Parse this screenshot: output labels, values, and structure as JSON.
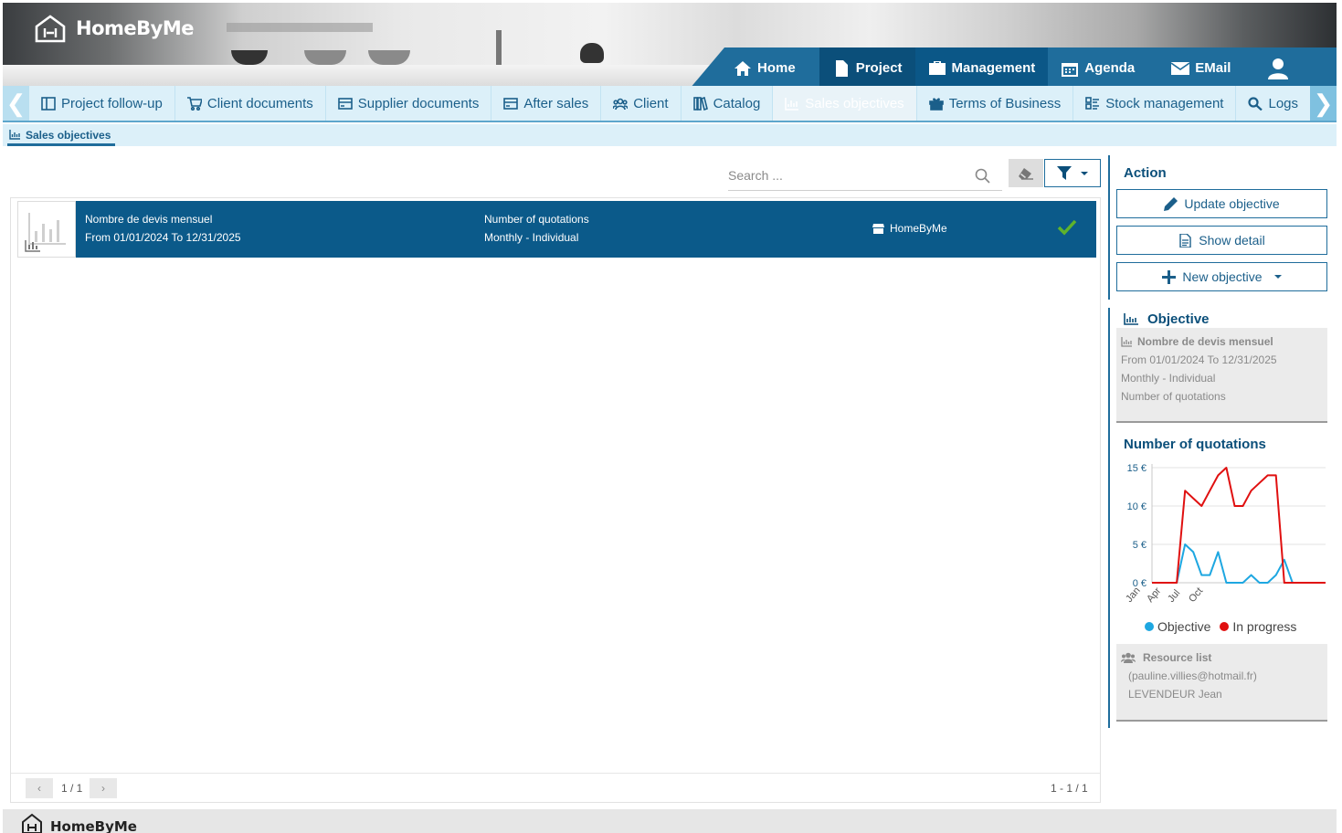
{
  "brand": {
    "name": "HomeByMe"
  },
  "main_nav": {
    "items": [
      {
        "label": "Home",
        "icon": "home-icon"
      },
      {
        "label": "Project",
        "icon": "file-icon"
      },
      {
        "label": "Management",
        "icon": "briefcase-icon"
      },
      {
        "label": "Agenda",
        "icon": "calendar-icon"
      },
      {
        "label": "EMail",
        "icon": "envelope-icon"
      }
    ],
    "active": "Project",
    "user_icon": "user-icon"
  },
  "sub_nav": {
    "tabs": [
      {
        "label": "Project follow-up",
        "icon": "columns-icon"
      },
      {
        "label": "Client documents",
        "icon": "cart-icon"
      },
      {
        "label": "Supplier documents",
        "icon": "card-icon"
      },
      {
        "label": "After sales",
        "icon": "card-icon"
      },
      {
        "label": "Client",
        "icon": "users-icon"
      },
      {
        "label": "Catalog",
        "icon": "books-icon"
      },
      {
        "label": "Sales objectives",
        "icon": "bar-chart-icon"
      },
      {
        "label": "Terms of Business",
        "icon": "gift-icon"
      },
      {
        "label": "Stock management",
        "icon": "boxes-icon"
      },
      {
        "label": "Logs",
        "icon": "search-icon"
      }
    ],
    "active": "Sales objectives",
    "prev_arrow": "❮",
    "next_arrow": "❯"
  },
  "breadcrumb": {
    "label": "Sales objectives"
  },
  "search": {
    "placeholder": "Search ..."
  },
  "list": {
    "rows": [
      {
        "title": "Nombre de devis mensuel",
        "period": "From 01/01/2024 To 12/31/2025",
        "type": "Number of quotations",
        "frequency": "Monthly - Individual",
        "store": "HomeByMe",
        "status": "check-icon"
      }
    ],
    "pager": {
      "page": "1 / 1",
      "range": "1 - 1 / 1",
      "prev": "‹",
      "next": "›"
    }
  },
  "action_panel": {
    "title": "Action",
    "buttons": {
      "update": "Update objective",
      "detail": "Show detail",
      "new": "New objective"
    }
  },
  "objective_panel": {
    "title": "Objective",
    "name": "Nombre de devis mensuel",
    "period": "From 01/01/2024 To 12/31/2025",
    "frequency": "Monthly - Individual",
    "type": "Number of quotations",
    "chart_title": "Number of quotations",
    "legend": {
      "objective": "Objective",
      "in_progress": "In progress"
    },
    "resources": {
      "title": "Resource list",
      "items": [
        "(pauline.villies@hotmail.fr)",
        "LEVENDEUR Jean"
      ]
    }
  },
  "colors": {
    "brand_blue": "#1f6d9c",
    "dark_blue": "#0b4f7a",
    "objective": "#1ea7e1",
    "in_progress": "#e01010",
    "check": "#5fb32b"
  },
  "chart_data": {
    "type": "line",
    "x_tick_labels": [
      "Jan",
      "Apr",
      "Jul",
      "Oct"
    ],
    "y_ticks": [
      "0 €",
      "5 €",
      "10 €",
      "15 €"
    ],
    "ylim": [
      0,
      15
    ],
    "xlim": [
      0,
      21
    ],
    "grid": true,
    "legend_position": "bottom",
    "series": [
      {
        "name": "Objective",
        "color": "#1ea7e1",
        "values": [
          0,
          0,
          0,
          0,
          5,
          4,
          1,
          1,
          4,
          0,
          0,
          0,
          1,
          0,
          0,
          1,
          3,
          0,
          0,
          0,
          0,
          0
        ]
      },
      {
        "name": "In progress",
        "color": "#e01010",
        "values": [
          0,
          0,
          0,
          0,
          12,
          11,
          10,
          12,
          14,
          15,
          10,
          10,
          12,
          13,
          14,
          14,
          0,
          0,
          0,
          0,
          0,
          0
        ]
      }
    ]
  }
}
